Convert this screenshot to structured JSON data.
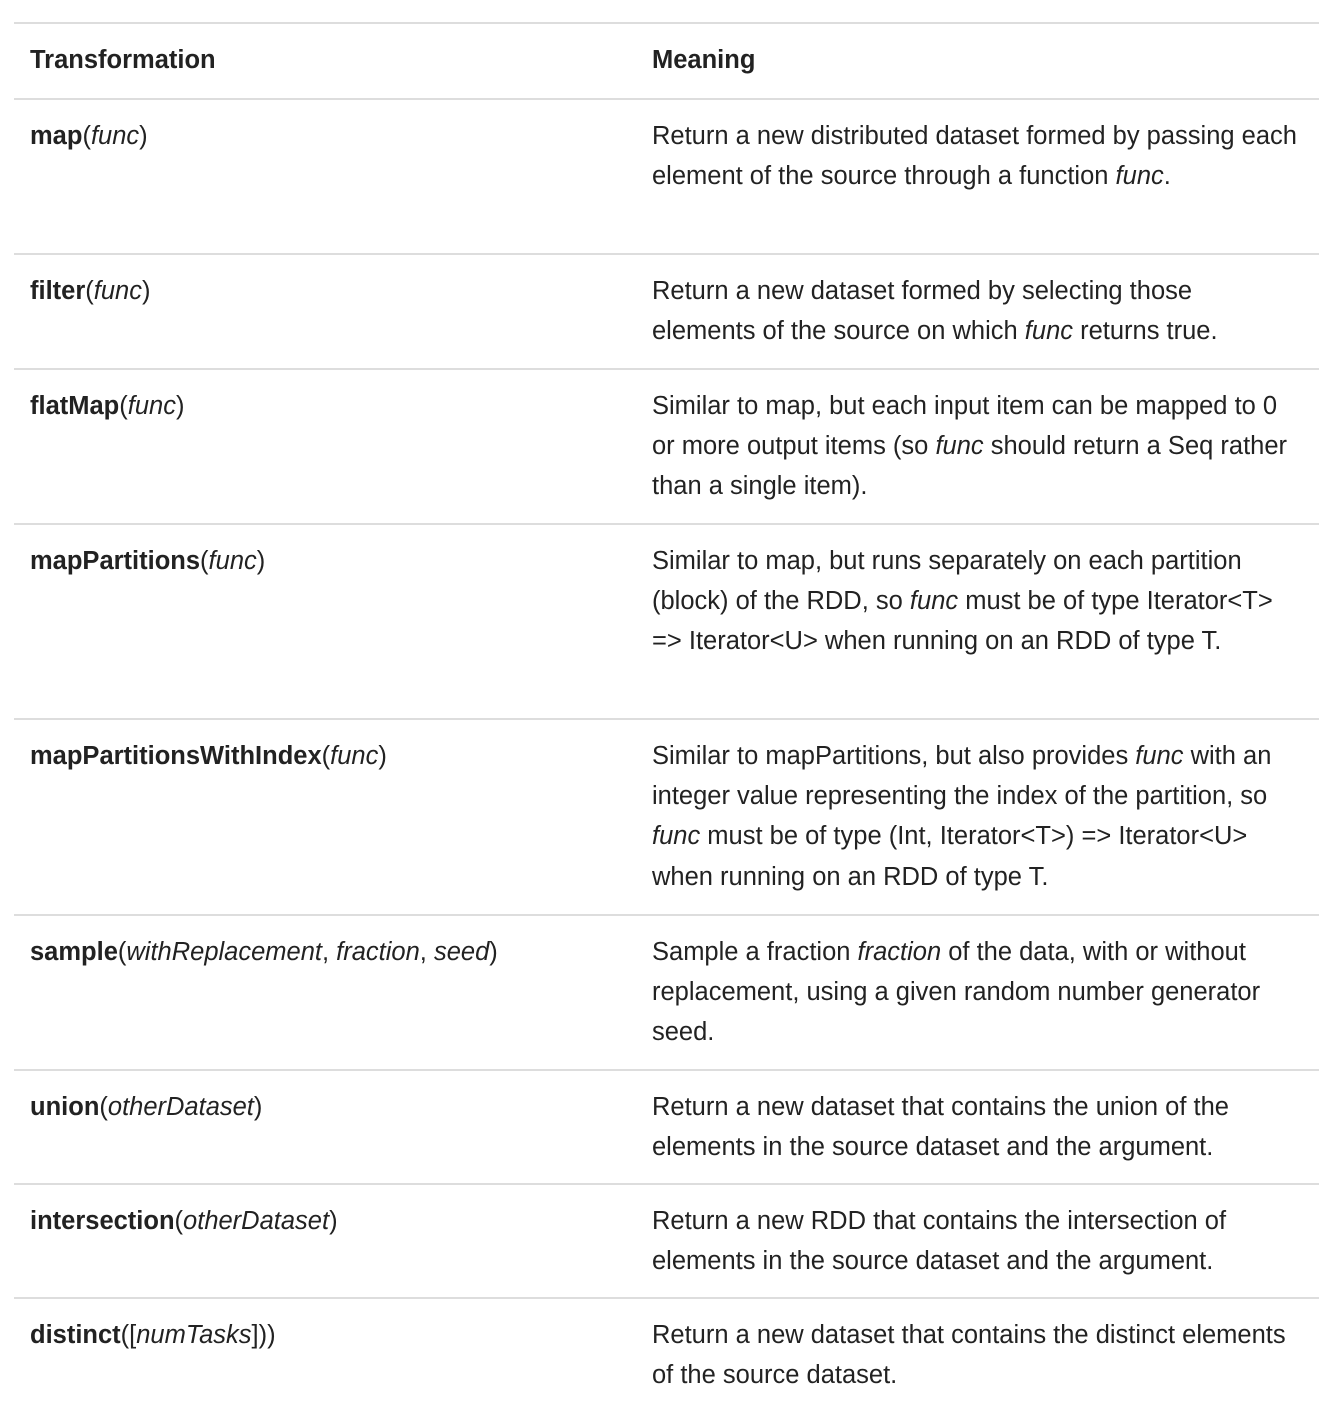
{
  "headers": {
    "transformation": "Transformation",
    "meaning": "Meaning"
  },
  "rows": [
    {
      "fn": "map",
      "sig": [
        {
          "t": "(",
          "i": false
        },
        {
          "t": "func",
          "i": true
        },
        {
          "t": ")",
          "i": false
        }
      ],
      "meaning": [
        {
          "t": "Return a new distributed dataset formed by passing each element of the source through a function ",
          "i": false
        },
        {
          "t": "func",
          "i": true
        },
        {
          "t": ".",
          "i": false
        }
      ]
    },
    {
      "fn": "filter",
      "sig": [
        {
          "t": "(",
          "i": false
        },
        {
          "t": "func",
          "i": true
        },
        {
          "t": ")",
          "i": false
        }
      ],
      "meaning": [
        {
          "t": "Return a new dataset formed by selecting those elements of the source on which ",
          "i": false
        },
        {
          "t": "func",
          "i": true
        },
        {
          "t": " returns true.",
          "i": false
        }
      ]
    },
    {
      "fn": "flatMap",
      "sig": [
        {
          "t": "(",
          "i": false
        },
        {
          "t": "func",
          "i": true
        },
        {
          "t": ")",
          "i": false
        }
      ],
      "meaning": [
        {
          "t": "Similar to map, but each input item can be mapped to 0 or more output items (so ",
          "i": false
        },
        {
          "t": "func",
          "i": true
        },
        {
          "t": " should return a Seq rather than a single item).",
          "i": false
        }
      ]
    },
    {
      "fn": "mapPartitions",
      "sig": [
        {
          "t": "(",
          "i": false
        },
        {
          "t": "func",
          "i": true
        },
        {
          "t": ")",
          "i": false
        }
      ],
      "meaning": [
        {
          "t": "Similar to map, but runs separately on each partition (block) of the RDD, so ",
          "i": false
        },
        {
          "t": "func",
          "i": true
        },
        {
          "t": " must be of type Iterator<T> => Iterator<U> when running on an RDD of type T.",
          "i": false
        }
      ]
    },
    {
      "fn": "mapPartitionsWithIndex",
      "sig": [
        {
          "t": "(",
          "i": false
        },
        {
          "t": "func",
          "i": true
        },
        {
          "t": ")",
          "i": false
        }
      ],
      "meaning": [
        {
          "t": "Similar to mapPartitions, but also provides ",
          "i": false
        },
        {
          "t": "func",
          "i": true
        },
        {
          "t": " with an integer value representing the index of the partition, so ",
          "i": false
        },
        {
          "t": "func",
          "i": true
        },
        {
          "t": " must be of type (Int, Iterator<T>) => Iterator<U> when running on an RDD of type T.",
          "i": false
        }
      ]
    },
    {
      "fn": "sample",
      "sig": [
        {
          "t": "(",
          "i": false
        },
        {
          "t": "withReplacement",
          "i": true
        },
        {
          "t": ", ",
          "i": false
        },
        {
          "t": "fraction",
          "i": true
        },
        {
          "t": ", ",
          "i": false
        },
        {
          "t": "seed",
          "i": true
        },
        {
          "t": ")",
          "i": false
        }
      ],
      "meaning": [
        {
          "t": "Sample a fraction ",
          "i": false
        },
        {
          "t": "fraction",
          "i": true
        },
        {
          "t": " of the data, with or without replacement, using a given random number generator seed.",
          "i": false
        }
      ]
    },
    {
      "fn": "union",
      "sig": [
        {
          "t": "(",
          "i": false
        },
        {
          "t": "otherDataset",
          "i": true
        },
        {
          "t": ")",
          "i": false
        }
      ],
      "meaning": [
        {
          "t": "Return a new dataset that contains the union of the elements in the source dataset and the argument.",
          "i": false
        }
      ]
    },
    {
      "fn": "intersection",
      "sig": [
        {
          "t": "(",
          "i": false
        },
        {
          "t": "otherDataset",
          "i": true
        },
        {
          "t": ")",
          "i": false
        }
      ],
      "meaning": [
        {
          "t": "Return a new RDD that contains the intersection of elements in the source dataset and the argument.",
          "i": false
        }
      ]
    },
    {
      "fn": "distinct",
      "sig": [
        {
          "t": "([",
          "i": false
        },
        {
          "t": "numTasks",
          "i": true
        },
        {
          "t": "]))",
          "i": false
        }
      ],
      "meaning": [
        {
          "t": "Return a new dataset that contains the distinct elements of the source dataset.",
          "i": false
        }
      ]
    }
  ]
}
